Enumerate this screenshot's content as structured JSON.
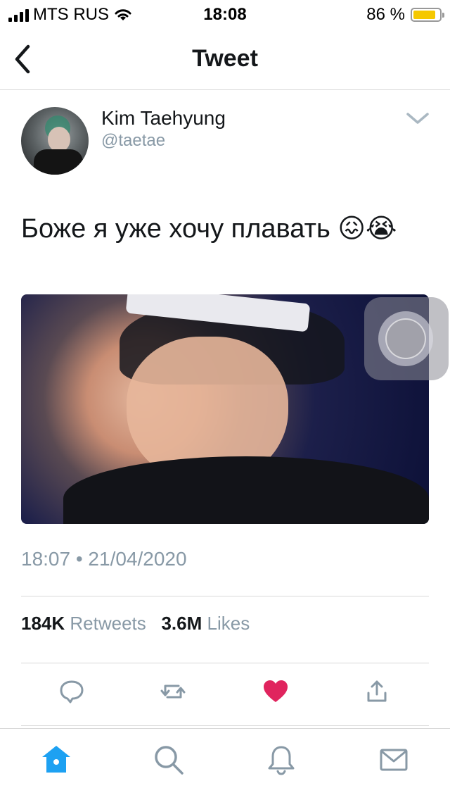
{
  "status_bar": {
    "carrier": "MTS RUS",
    "time": "18:08",
    "battery_percent_text": "86 %",
    "battery_level": 0.86,
    "battery_color": "#f5c800"
  },
  "nav": {
    "title": "Tweet",
    "back_icon": "chevron-left-icon"
  },
  "tweet": {
    "author_name": "Kim Taehyung",
    "author_handle": "@taetae",
    "text": "Боже я уже хочу плавать 😖😭",
    "timestamp": "18:07 • 21/04/2020",
    "retweets_count": "184K",
    "retweets_label": "Retweets",
    "likes_count": "3.6M",
    "likes_label": "Likes",
    "liked": true
  },
  "actions": {
    "reply_icon": "reply-icon",
    "retweet_icon": "retweet-icon",
    "like_icon": "heart-icon",
    "share_icon": "share-icon",
    "like_color": "#e0245e"
  },
  "tab_bar": {
    "active": "home",
    "accent_color": "#1da1f2",
    "items": [
      {
        "name": "home",
        "icon": "home-icon"
      },
      {
        "name": "search",
        "icon": "search-icon"
      },
      {
        "name": "notifications",
        "icon": "bell-icon"
      },
      {
        "name": "messages",
        "icon": "mail-icon"
      }
    ]
  }
}
